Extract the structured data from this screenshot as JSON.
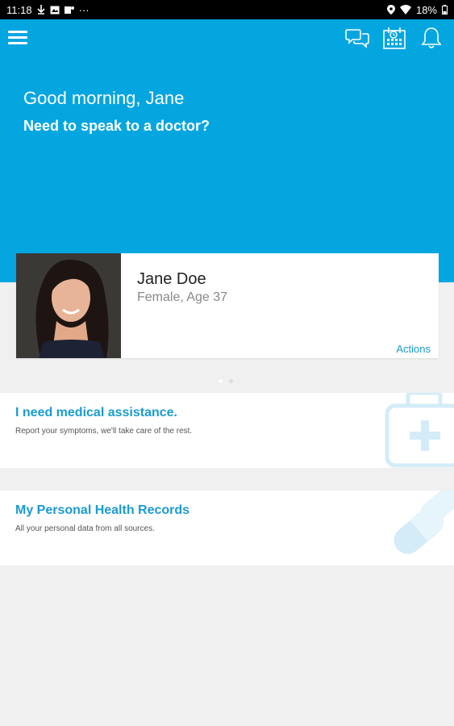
{
  "status_bar": {
    "time": "11:18",
    "dots": "···",
    "battery": "18%"
  },
  "header": {
    "greeting": "Good morning, Jane",
    "question": "Need to speak to a doctor?"
  },
  "profile": {
    "name": "Jane Doe",
    "meta": "Female, Age 37",
    "actions_label": "Actions"
  },
  "carousel": {
    "page": 1,
    "count": 2
  },
  "tiles": [
    {
      "title": "I need medical assistance.",
      "description": "Report your symptoms, we'll take care of the rest.",
      "icon": "first-aid-kit-icon"
    },
    {
      "title": "My Personal Health Records",
      "description": "All your personal data from all sources.",
      "icon": "pills-icon"
    }
  ],
  "colors": {
    "primary": "#04a6e0",
    "link": "#1a9bd0",
    "background": "#f0f0f0"
  }
}
